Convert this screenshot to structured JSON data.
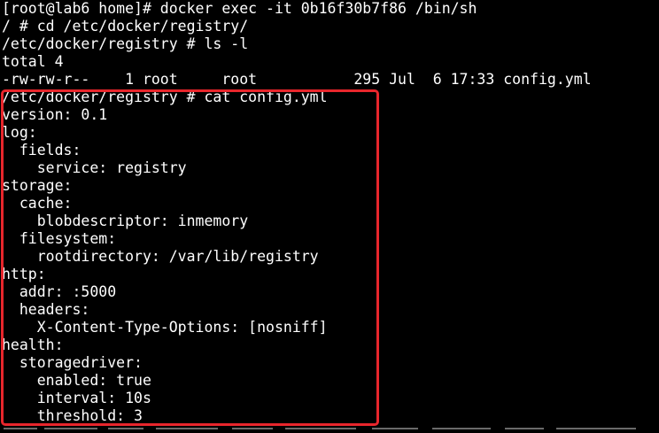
{
  "terminal": {
    "lines": [
      "[root@lab6 home]# docker exec -it 0b16f30b7f86 /bin/sh",
      "/ # cd /etc/docker/registry/",
      "/etc/docker/registry # ls -l",
      "total 4",
      "-rw-rw-r--    1 root     root           295 Jul  6 17:33 config.yml",
      "/etc/docker/registry # cat config.yml",
      "version: 0.1",
      "log:",
      "  fields:",
      "    service: registry",
      "storage:",
      "  cache:",
      "    blobdescriptor: inmemory",
      "  filesystem:",
      "    rootdirectory: /var/lib/registry",
      "http:",
      "  addr: :5000",
      "  headers:",
      "    X-Content-Type-Options: [nosniff]",
      "health:",
      "  storagedriver:",
      "    enabled: true",
      "    interval: 10s",
      "    threshold: 3"
    ]
  },
  "colors": {
    "background": "#000000",
    "text": "#ffffff",
    "highlight_border": "#e8262c"
  }
}
